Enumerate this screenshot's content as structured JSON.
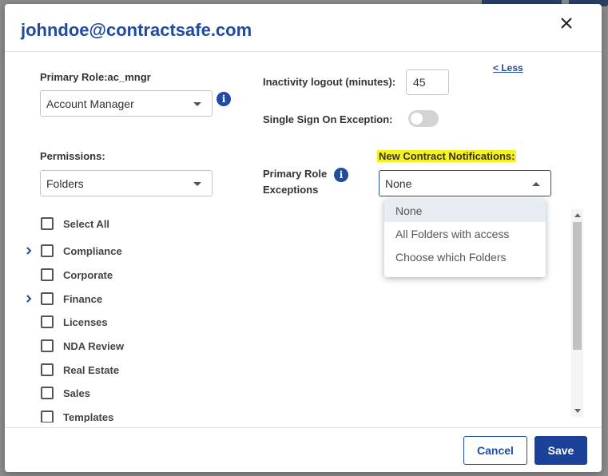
{
  "modal": {
    "title": "johndoe@contractsafe.com"
  },
  "primary_role": {
    "label": "Primary Role:ac_mngr",
    "selected": "Account Manager"
  },
  "permissions": {
    "label": "Permissions:",
    "selected": "Folders"
  },
  "inactivity": {
    "label": "Inactivity logout (minutes):",
    "value": "45"
  },
  "sso": {
    "label": "Single Sign On Exception:",
    "enabled": false
  },
  "less_link": "< Less",
  "role_exceptions": {
    "label_line1": "Primary Role",
    "label_line2": "Exceptions"
  },
  "notifications": {
    "label": "New Contract Notifications:",
    "selected": "None",
    "options": [
      "None",
      "All Folders with access",
      "Choose which Folders"
    ]
  },
  "folders": {
    "select_all": "Select All",
    "items": [
      {
        "label": "Compliance",
        "expandable": true
      },
      {
        "label": "Corporate",
        "expandable": false
      },
      {
        "label": "Finance",
        "expandable": true
      },
      {
        "label": "Licenses",
        "expandable": false
      },
      {
        "label": "NDA Review",
        "expandable": false
      },
      {
        "label": "Real Estate",
        "expandable": false
      },
      {
        "label": "Sales",
        "expandable": false
      },
      {
        "label": "Templates",
        "expandable": false
      }
    ]
  },
  "footer": {
    "cancel": "Cancel",
    "save": "Save"
  },
  "colors": {
    "brand": "#1f4ba0",
    "save_button": "#1a4299",
    "highlight": "#f7f21b"
  },
  "icons": [
    "close-icon",
    "info-icon",
    "chevron-right-icon",
    "caret-down-icon",
    "caret-up-icon"
  ]
}
